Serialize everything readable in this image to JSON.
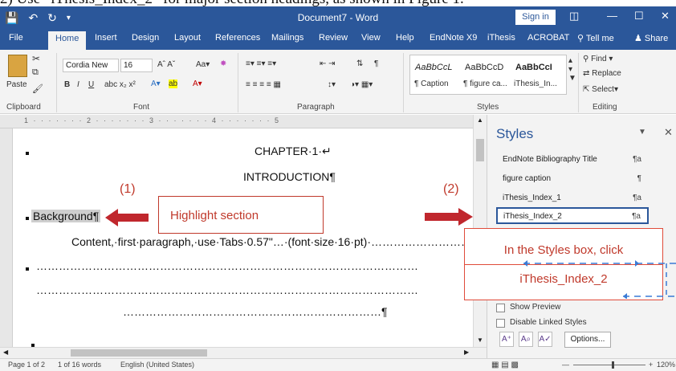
{
  "instruction": "2) Use “iThesis_Index_2” for major section headings, as shown in Figure 1.",
  "window": {
    "title": "Document7 - Word",
    "sign_in": "Sign in"
  },
  "tabs": [
    "File",
    "Home",
    "Insert",
    "Design",
    "Layout",
    "References",
    "Mailings",
    "Review",
    "View",
    "Help",
    "EndNote X9",
    "iThesis",
    "ACROBAT",
    "Tell me",
    "Share"
  ],
  "ribbon": {
    "paste_label": "Paste",
    "font_name": "Cordia New",
    "font_size": "16",
    "style_gallery": [
      {
        "sample": "AaBbCcL",
        "name": "¶ Caption"
      },
      {
        "sample": "AaBbCcD",
        "name": "¶ figure ca..."
      },
      {
        "sample": "AaBbCcI",
        "name": "iThesis_In..."
      }
    ],
    "find_label": "Find",
    "replace_label": "Replace",
    "select_label": "Select",
    "group_labels": {
      "clipboard": "Clipboard",
      "font": "Font",
      "paragraph": "Paragraph",
      "styles": "Styles",
      "editing": "Editing"
    }
  },
  "ruler_numbers": "1 · · · · · · · 2 · · · · · · · 3 · · · · · · · 4 · · · · · · · 5",
  "document": {
    "chapter": "CHAPTER·1·↵",
    "heading": "INTRODUCTION¶",
    "section": "Background¶",
    "content": "Content,·first·paragraph,·use·Tabs·0.57\"…·(font·size·16·pt)·………………………",
    "dots_line1": "…………………………………………………………………………………………",
    "dots_line2": "…………………………………………………………………………………………",
    "dots_line3": "……………………………………………………………¶"
  },
  "annotations": {
    "step1": "(1)",
    "step2": "(2)",
    "highlight": "Highlight section",
    "styles_line1": "In the Styles box, click",
    "styles_line2": "iThesis_Index_2"
  },
  "styles_pane": {
    "title": "Styles",
    "items": [
      {
        "name": "EndNote Bibliography Title",
        "mark": "¶a"
      },
      {
        "name": "figure caption",
        "mark": "¶"
      },
      {
        "name": "iThesis_Index_1",
        "mark": "¶a"
      },
      {
        "name": "iThesis_Index_2",
        "mark": "¶a"
      }
    ],
    "selected": "iThesis_Index_2",
    "show_preview": "Show Preview",
    "disable_linked": "Disable Linked Styles",
    "options": "Options..."
  },
  "status": {
    "page": "Page 1 of 2",
    "words": "1 of 16 words",
    "language": "English (United States)",
    "zoom": "120%"
  }
}
